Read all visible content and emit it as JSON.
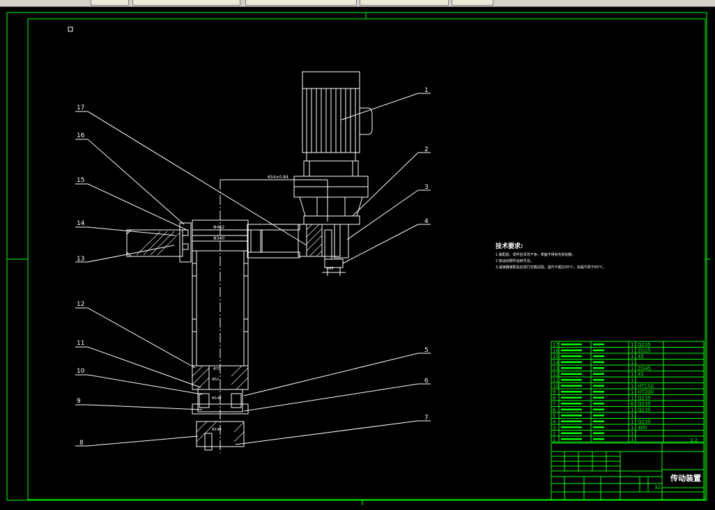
{
  "window": {
    "tabs": [
      "",
      "",
      "",
      "",
      ""
    ]
  },
  "drawing": {
    "title_block_name": "传动装置",
    "tech_req_title": "技术要求:",
    "tech_req_lines": [
      "1.装配前，零件应清洗干净，表面不得有毛刺划痕。",
      "2.各运动部件运转灵活。",
      "3.减速器装配后应进行空载试验，温升不超过45℃，油温不高于65℃。"
    ],
    "callouts": [
      "1",
      "2",
      "3",
      "4",
      "5",
      "6",
      "7",
      "8",
      "9",
      "10",
      "11",
      "12",
      "13",
      "14",
      "15",
      "16",
      "17"
    ],
    "dims": {
      "top_dim": "654±0.84",
      "d1": "Φ462",
      "d2": "Φ340",
      "d3": "Φ70",
      "d4": "Φ52",
      "d5": "Φ140",
      "d6": "Φ140",
      "d7": "Φ95"
    },
    "bom": {
      "nos": [
        "17",
        "16",
        "15",
        "14",
        "13",
        "12",
        "11",
        "10",
        "9",
        "8",
        "7",
        "6",
        "5",
        "4",
        "3",
        "2",
        "1"
      ],
      "qty": [
        "1",
        "1",
        "1",
        "1",
        "1",
        "1",
        "1",
        "1",
        "1",
        "1",
        "6",
        "1",
        "1",
        "1",
        "1",
        "1",
        "1"
      ],
      "materials": [
        "Q235",
        "ZG25",
        "45",
        "",
        "ZG45",
        "45",
        "",
        "HT150",
        "HT200",
        "Q235",
        "Q235",
        "Q235",
        "",
        "Q235",
        "400",
        "",
        ""
      ],
      "notes": [
        "",
        "",
        "",
        "",
        "",
        "",
        "",
        "",
        "",
        "",
        "",
        "",
        "",
        "",
        "",
        "",
        ""
      ]
    },
    "scale": "1:2",
    "sheet": "32"
  }
}
